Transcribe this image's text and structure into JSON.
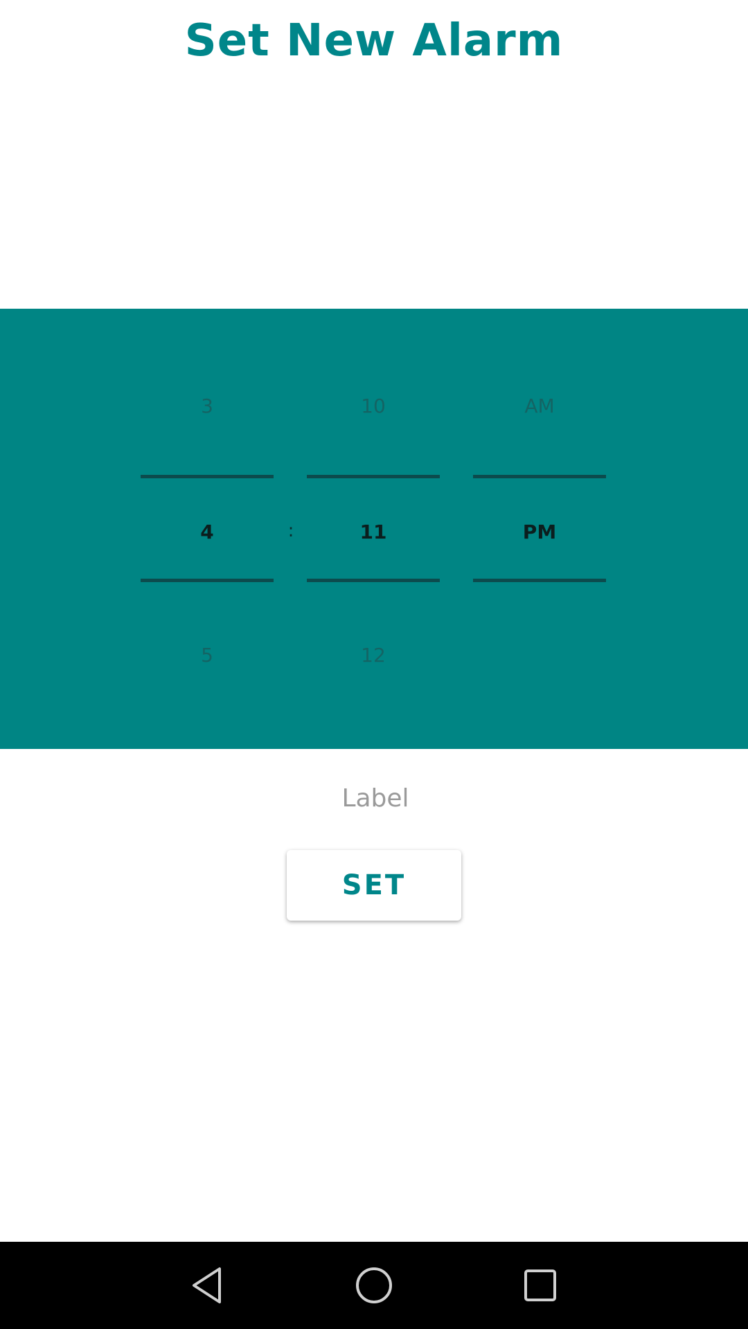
{
  "header": {
    "title": "Set New Alarm"
  },
  "time_picker": {
    "hour": {
      "previous": "3",
      "selected": "4",
      "next": "5"
    },
    "separator": ":",
    "minute": {
      "previous": "10",
      "selected": "11",
      "next": "12"
    },
    "period": {
      "previous": "AM",
      "selected": "PM"
    }
  },
  "label_field": {
    "value": "",
    "placeholder": "Label"
  },
  "set_button": {
    "label": "SET"
  },
  "nav_bar": {
    "back_icon": "triangle-back-icon",
    "home_icon": "circle-home-icon",
    "recents_icon": "square-recents-icon"
  },
  "colors": {
    "accent": "#00868a",
    "panel": "#008584",
    "divider": "#0c4b4d",
    "nav_bar": "#000000"
  }
}
